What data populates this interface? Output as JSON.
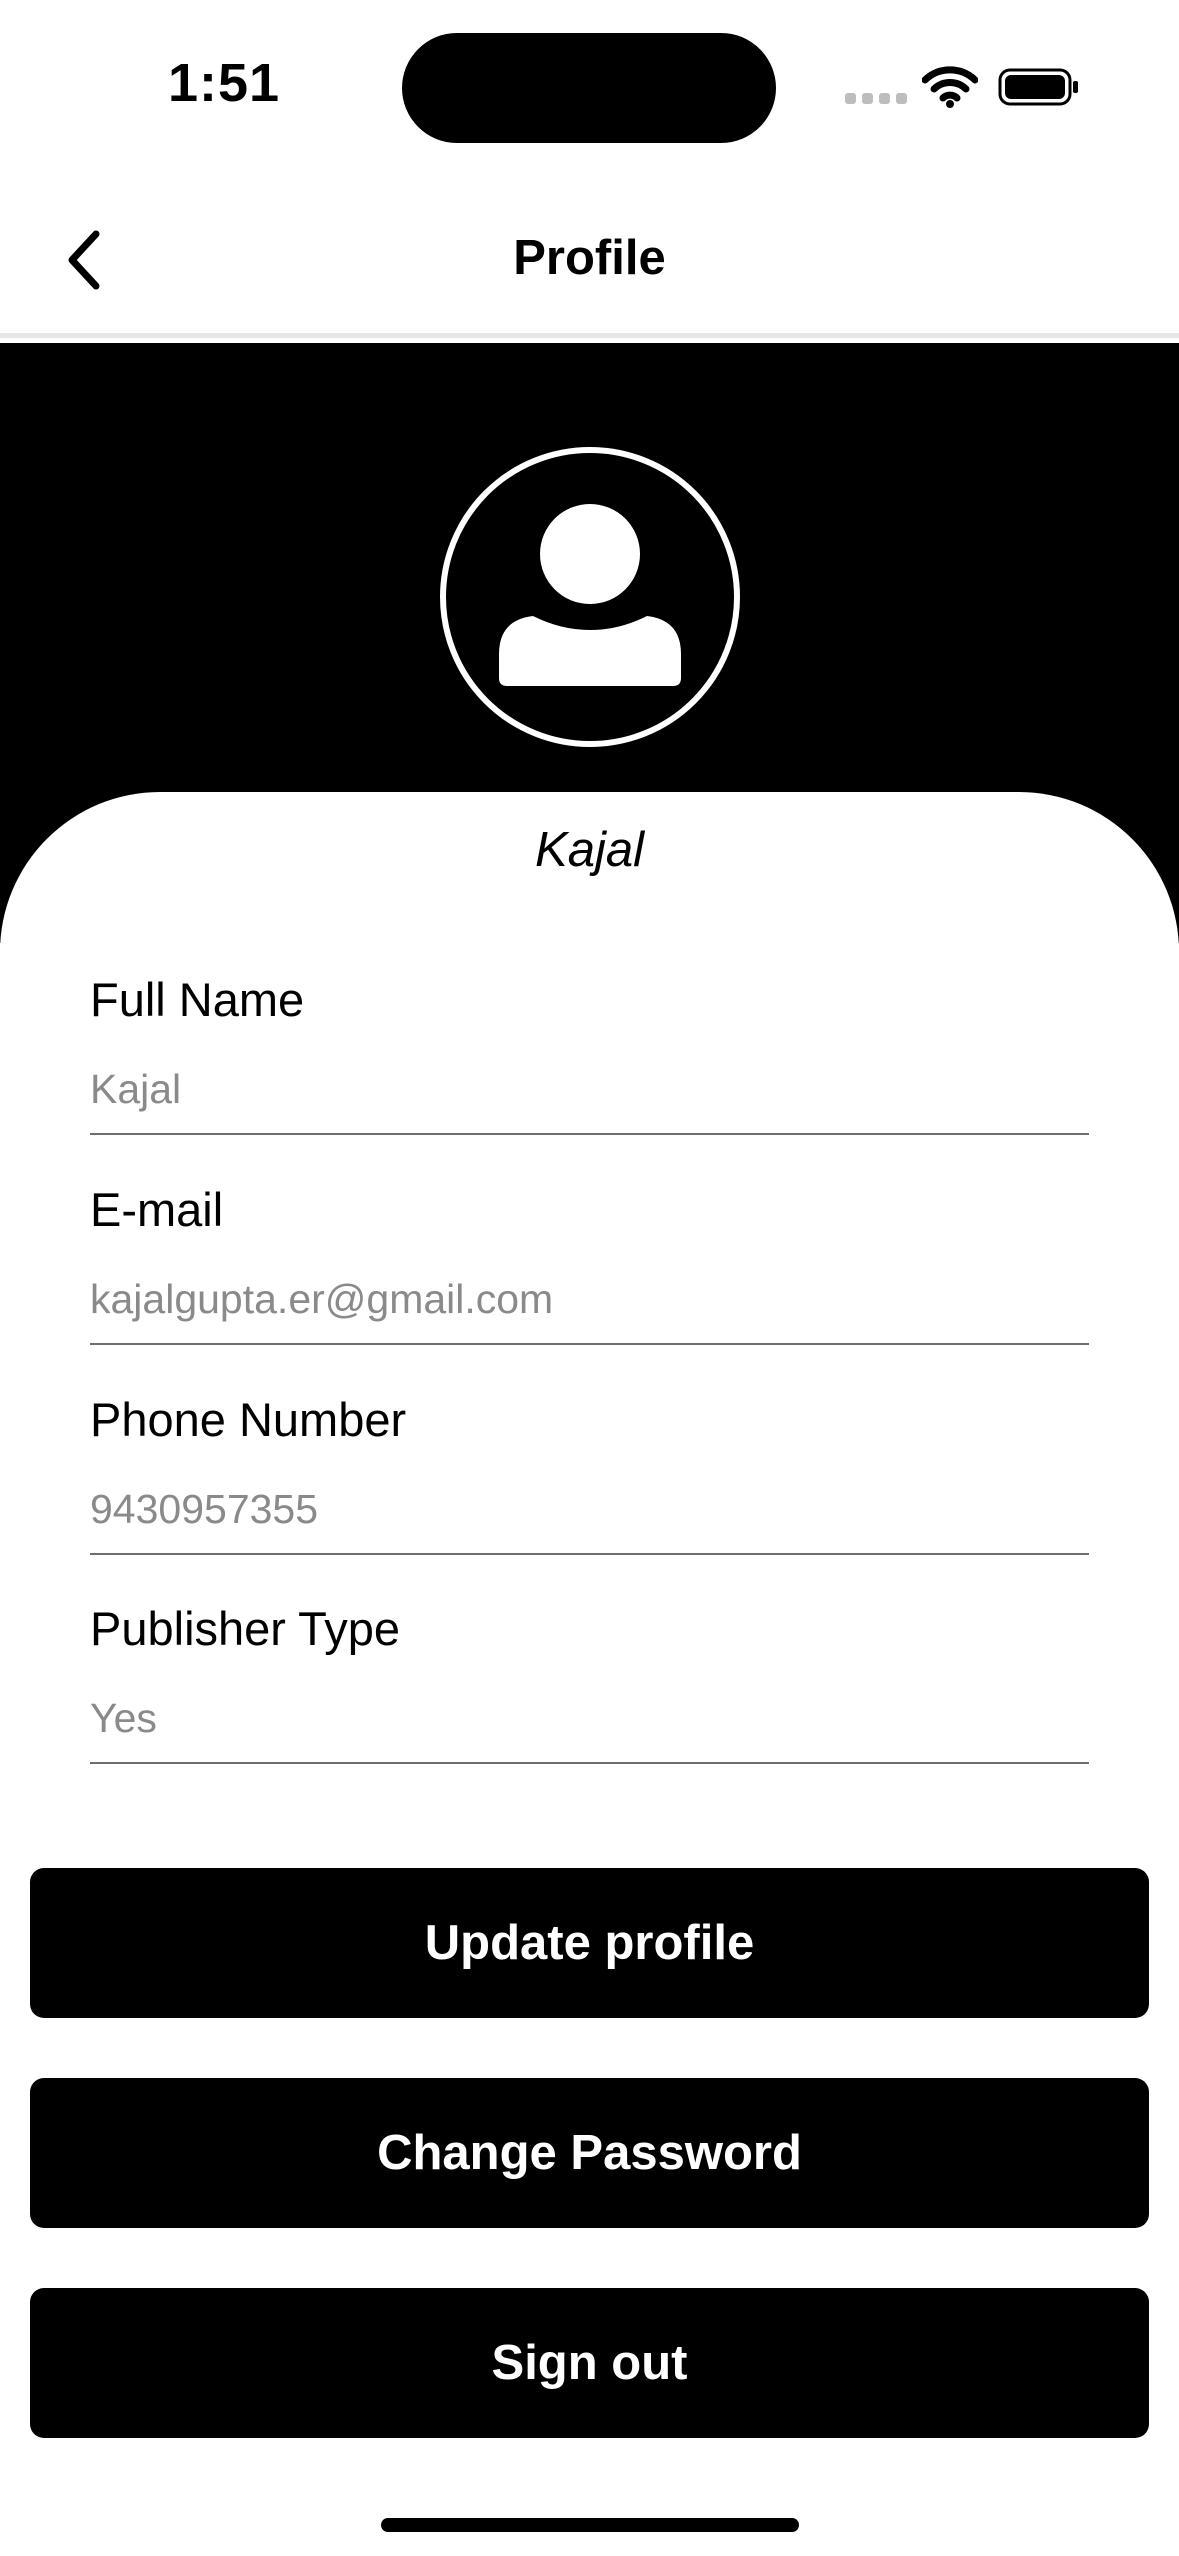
{
  "status_bar": {
    "time": "1:51"
  },
  "nav": {
    "title": "Profile"
  },
  "profile": {
    "display_name": "Kajal"
  },
  "fields": [
    {
      "label": "Full Name",
      "placeholder": "Kajal"
    },
    {
      "label": "E-mail",
      "placeholder": "kajalgupta.er@gmail.com"
    },
    {
      "label": "Phone Number",
      "placeholder": "9430957355"
    },
    {
      "label": "Publisher Type",
      "placeholder": "Yes"
    }
  ],
  "buttons": {
    "update": "Update profile",
    "change_password": "Change Password",
    "sign_out": "Sign out"
  },
  "icons": {
    "back": "chevron-left-icon",
    "avatar": "person-icon",
    "wifi": "wifi-icon",
    "battery": "battery-icon",
    "signal": "cellular-signal-icon"
  },
  "colors": {
    "primary": "#000000",
    "background": "#ffffff",
    "placeholder": "#8a8a8a"
  }
}
